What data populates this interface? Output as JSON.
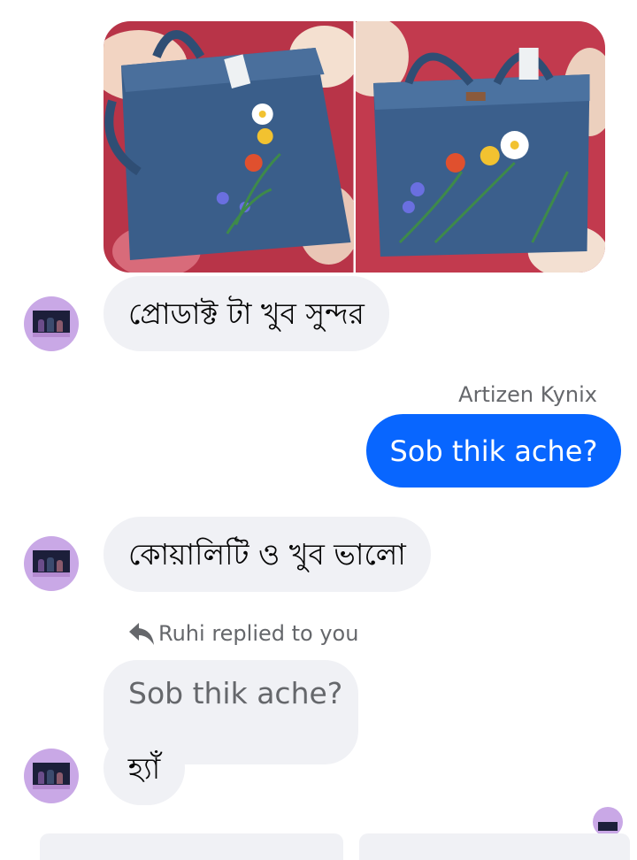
{
  "messages": {
    "photos": [
      "denim-tote-photo-left",
      "denim-tote-photo-right"
    ],
    "received_1": "প্রোডাক্ট টা খুব সুন্দর",
    "sent_sender": "Artizen Kynix",
    "sent_1": "Sob thik ache?",
    "received_2": "কোয়ালিটি ও খুব ভালো",
    "reply_label": "Ruhi replied to you",
    "quoted_text": "Sob thik ache?",
    "received_3": "হ্যাঁ"
  },
  "colors": {
    "sent_bubble": "#0866ff",
    "received_bubble": "#f0f1f5",
    "meta_text": "#65676b"
  },
  "icons": [
    "reply-arrow-icon"
  ]
}
